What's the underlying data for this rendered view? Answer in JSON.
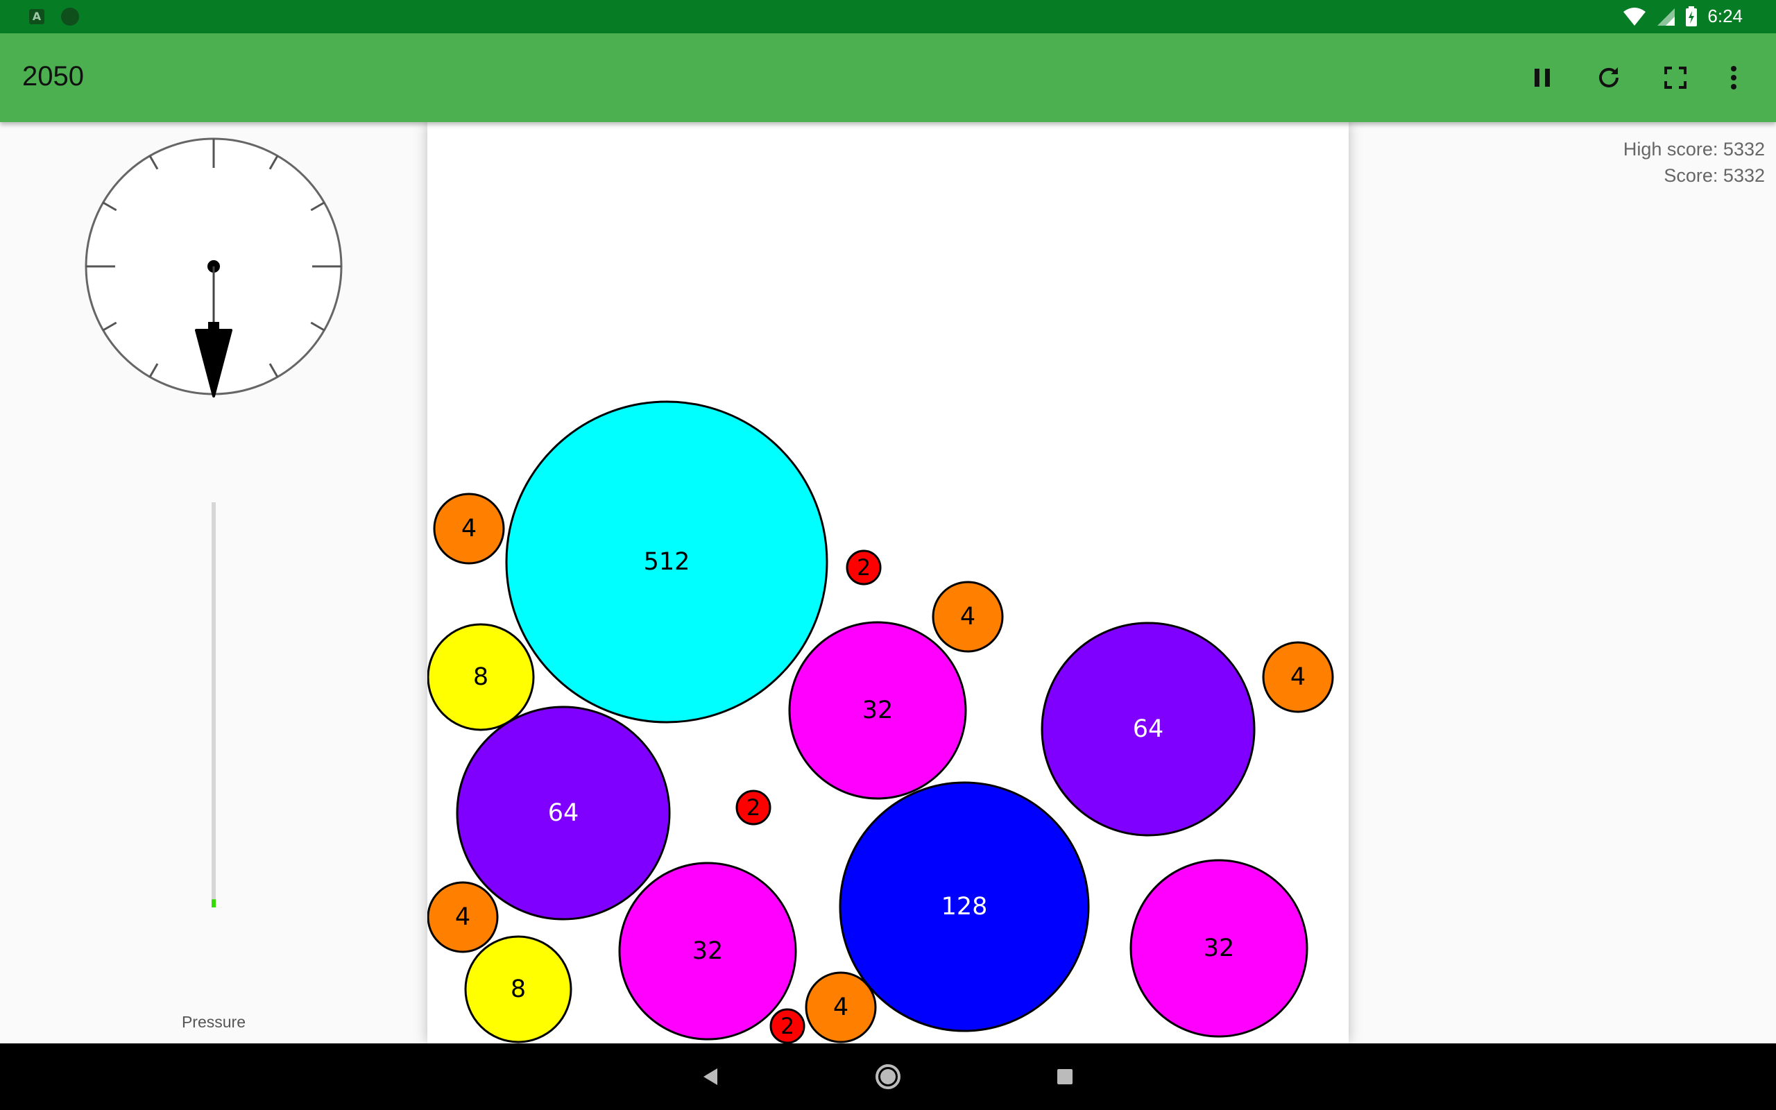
{
  "status_bar": {
    "time": "6:24",
    "icons": [
      "a-notification-icon",
      "circle-notification-icon",
      "wifi-icon",
      "signal-icon",
      "battery-icon"
    ]
  },
  "app_bar": {
    "title": "2050",
    "actions": [
      "pause-icon",
      "restart-icon",
      "fullscreen-icon",
      "more-vert-icon"
    ]
  },
  "scores": {
    "high_score": "High score: 5332",
    "score": "Score: 5332"
  },
  "left_panel": {
    "pressure_label": "Pressure",
    "pressure_level": 0.02,
    "pressure_color": "#33dd00",
    "gauge_needle_direction": "down"
  },
  "colors": {
    "status_bar": "#067d24",
    "app_bar": "#4caf50",
    "ball_2": "#ff0000",
    "ball_4": "#ff8000",
    "ball_8": "#ffff00",
    "ball_32": "#ff00ff",
    "ball_64": "#8000ff",
    "ball_128": "#0000ff",
    "ball_512": "#00ffff"
  },
  "balls": [
    {
      "value": "512",
      "color": "#00ffff",
      "text": "#000"
    },
    {
      "value": "4",
      "color": "#ff8000",
      "text": "#000"
    },
    {
      "value": "2",
      "color": "#ff0000",
      "text": "#000"
    },
    {
      "value": "4",
      "color": "#ff8000",
      "text": "#000"
    },
    {
      "value": "8",
      "color": "#ffff00",
      "text": "#000"
    },
    {
      "value": "32",
      "color": "#ff00ff",
      "text": "#000"
    },
    {
      "value": "64",
      "color": "#8000ff",
      "text": "#fff"
    },
    {
      "value": "4",
      "color": "#ff8000",
      "text": "#000"
    },
    {
      "value": "64",
      "color": "#8000ff",
      "text": "#fff"
    },
    {
      "value": "2",
      "color": "#ff0000",
      "text": "#000"
    },
    {
      "value": "4",
      "color": "#ff8000",
      "text": "#000"
    },
    {
      "value": "8",
      "color": "#ffff00",
      "text": "#000"
    },
    {
      "value": "32",
      "color": "#ff00ff",
      "text": "#000"
    },
    {
      "value": "128",
      "color": "#0000ff",
      "text": "#fff"
    },
    {
      "value": "32",
      "color": "#ff00ff",
      "text": "#000"
    },
    {
      "value": "4",
      "color": "#ff8000",
      "text": "#000"
    },
    {
      "value": "2",
      "color": "#ff0000",
      "text": "#000"
    }
  ],
  "nav_bar": {
    "buttons": [
      "back-icon",
      "home-icon",
      "recents-icon"
    ]
  }
}
